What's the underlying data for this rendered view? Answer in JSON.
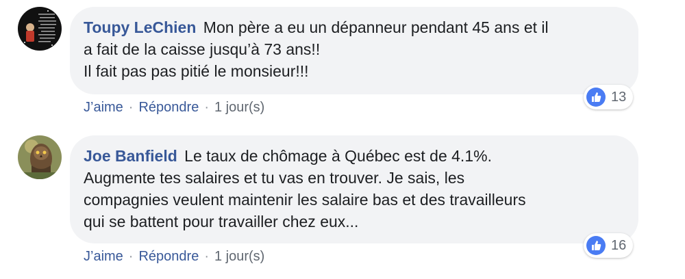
{
  "comments": [
    {
      "author": "Toupy LeChien",
      "text_lines": [
        "Mon père a eu un dépanneur pendant 45 ans et il",
        "a fait de la caisse jusqu’à 73 ans!!",
        "Il fait pas pas pitié le monsieur!!!"
      ],
      "reaction_count": "13",
      "like_label": "J’aime",
      "reply_label": "Répondre",
      "separator": "·",
      "time": "1 jour(s)",
      "avatar_icon": "dark-text-avatar"
    },
    {
      "author": "Joe Banfield",
      "text_lines": [
        "Le taux de chômage à Québec est de 4.1%.",
        "Augmente tes salaires et tu vas en trouver. Je sais, les",
        "compagnies veulent maintenir les salaire bas et des travailleurs",
        "qui se battent pour travailler chez eux..."
      ],
      "reaction_count": "16",
      "like_label": "J’aime",
      "reply_label": "Répondre",
      "separator": "·",
      "time": "1 jour(s)",
      "avatar_icon": "owl-avatar"
    }
  ],
  "colors": {
    "author": "#385898",
    "bubble": "#f2f3f5",
    "like_badge": "#4a7cf3",
    "meta_text": "#606770"
  }
}
